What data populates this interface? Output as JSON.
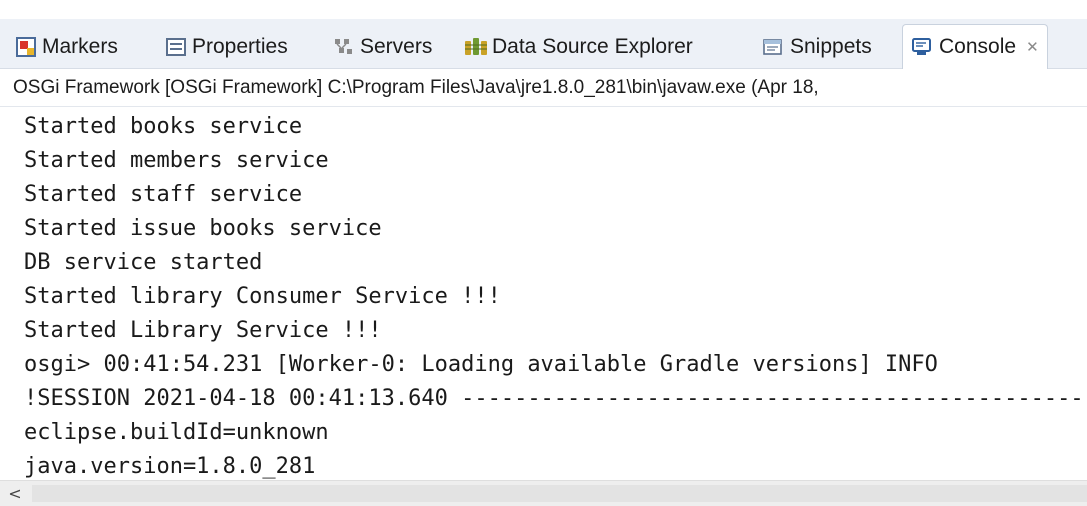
{
  "tabs": [
    {
      "label": "Markers",
      "icon": "markers-icon",
      "active": false
    },
    {
      "label": "Properties",
      "icon": "properties-icon",
      "active": false
    },
    {
      "label": "Servers",
      "icon": "servers-icon",
      "active": false
    },
    {
      "label": "Data Source Explorer",
      "icon": "data-source-explorer-icon",
      "active": false
    },
    {
      "label": "Snippets",
      "icon": "snippets-icon",
      "active": false
    },
    {
      "label": "Console",
      "icon": "console-icon",
      "active": true
    }
  ],
  "console": {
    "close_glyph": "✕",
    "process_info": "OSGi Framework [OSGi Framework] C:\\Program Files\\Java\\jre1.8.0_281\\bin\\javaw.exe (Apr 18,",
    "lines": [
      "Started books service",
      "Started members service",
      "Started staff service",
      "Started issue books service",
      "DB service started",
      "Started library Consumer Service !!!",
      "Started Library Service !!!",
      "osgi> 00:41:54.231 [Worker-0: Loading available Gradle versions] INFO",
      "!SESSION 2021-04-18 00:41:13.640 -----------------------------------------------",
      "eclipse.buildId=unknown",
      "java.version=1.8.0_281"
    ]
  },
  "scrollbar": {
    "left_arrow": "<"
  },
  "colors": {
    "tabbar_bg": "#edf1f7",
    "text": "#1a1a1a"
  }
}
